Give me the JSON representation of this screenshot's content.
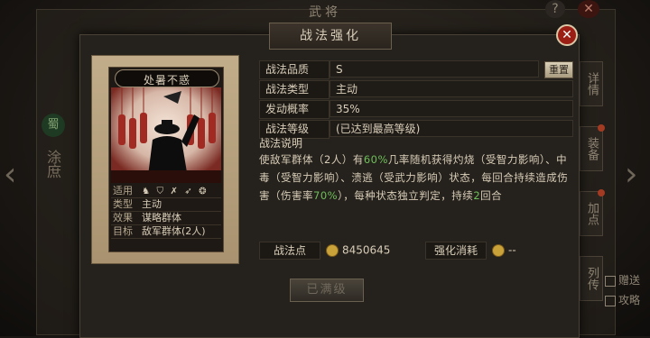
{
  "background": {
    "title": "武将",
    "help_label": "?",
    "side_badge": "蜀",
    "side_name": "涂庶",
    "tabs": [
      "详情",
      "装备",
      "加点",
      "列传"
    ],
    "bottom_links": [
      "赠送",
      "攻略"
    ]
  },
  "modal": {
    "title": "战法强化",
    "close_label": "✕"
  },
  "card": {
    "name": "处暑不惑",
    "rows": [
      {
        "k": "适用",
        "v": ""
      },
      {
        "k": "类型",
        "v": "主动"
      },
      {
        "k": "效果",
        "v": "谋略群体"
      },
      {
        "k": "目标",
        "v": "敌军群体(2人)"
      }
    ],
    "applicable_icons": [
      "horse-icon",
      "shield-icon",
      "crossbow-icon",
      "spear-icon",
      "siege-icon"
    ]
  },
  "attributes": {
    "quality_label": "战法品质",
    "quality_value": "S",
    "type_label": "战法类型",
    "type_value": "主动",
    "chance_label": "发动概率",
    "chance_value": "35%",
    "level_label": "战法等级",
    "level_value": "(已达到最高等级)",
    "reset_label": "重置"
  },
  "description": {
    "title": "战法说明",
    "part1": "使敌军群体（2人）有",
    "pct1": "60%",
    "part2": "几率随机获得灼烧（受智力影响）、中毒（受智力影响）、溃逃（受武力影响）状态，每回合持续造成伤害（伤害率",
    "pct2": "70%",
    "part3": "），每种状态独立判定，持续",
    "turns": "2",
    "part4": "回合"
  },
  "costs": {
    "points_label": "战法点",
    "points_value": "8450645",
    "upgrade_label": "强化消耗",
    "upgrade_value": "--"
  },
  "action": {
    "maxed_label": "已满级"
  }
}
